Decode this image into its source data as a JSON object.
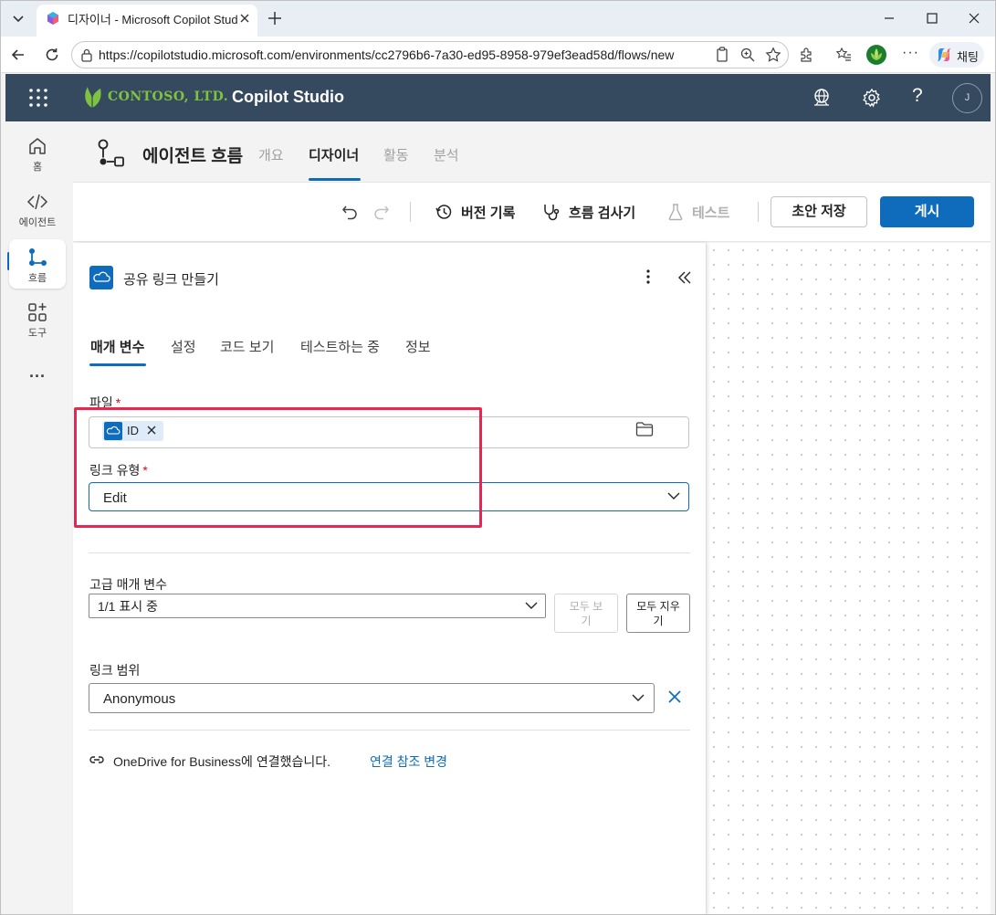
{
  "browser": {
    "tab_title": "디자이너 - Microsoft Copilot Studio",
    "url": "https://copilotstudio.microsoft.com/environments/cc2796b6-7a30-ed95-8958-979ef3ead58d/flows/new",
    "copilot_label": "채팅"
  },
  "header": {
    "brand": "CONTOSO, LTD.",
    "app_name": "Copilot Studio",
    "avatar_initial": "J"
  },
  "rail": {
    "items": [
      {
        "label": "홈",
        "icon": "home-icon"
      },
      {
        "label": "에이전트",
        "icon": "code-icon"
      },
      {
        "label": "흐름",
        "icon": "flow-icon"
      },
      {
        "label": "도구",
        "icon": "tools-icon"
      }
    ],
    "more": "..."
  },
  "page": {
    "title": "에이전트 흐름",
    "tabs": [
      "개요",
      "디자이너",
      "활동",
      "분석"
    ],
    "active_tab": "디자이너"
  },
  "toolbar": {
    "version_history": "버전 기록",
    "flow_checker": "흐름 검사기",
    "test": "테스트",
    "save_draft": "초안 저장",
    "publish": "게시"
  },
  "panel": {
    "title": "공유 링크 만들기",
    "tabs": [
      "매개 변수",
      "설정",
      "코드 보기",
      "테스트하는 중",
      "정보"
    ],
    "active_tab": "매개 변수",
    "file_label": "파일",
    "file_token": "ID",
    "link_type_label": "링크 유형",
    "link_type_value": "Edit",
    "advanced_label": "고급 매개 변수",
    "advanced_value": "1/1 표시 중",
    "show_all": "모두 보기",
    "clear_all": "모두 지우기",
    "scope_label": "링크 범위",
    "scope_value": "Anonymous",
    "connection_text": "OneDrive for Business에 연결했습니다.",
    "change_connection": "연결 참조 변경",
    "required_marker": "*"
  },
  "colors": {
    "header_bg": "#354a5f",
    "accent": "#0f6cbd",
    "highlight": "#e8264f",
    "brand_green": "#7fc241"
  }
}
